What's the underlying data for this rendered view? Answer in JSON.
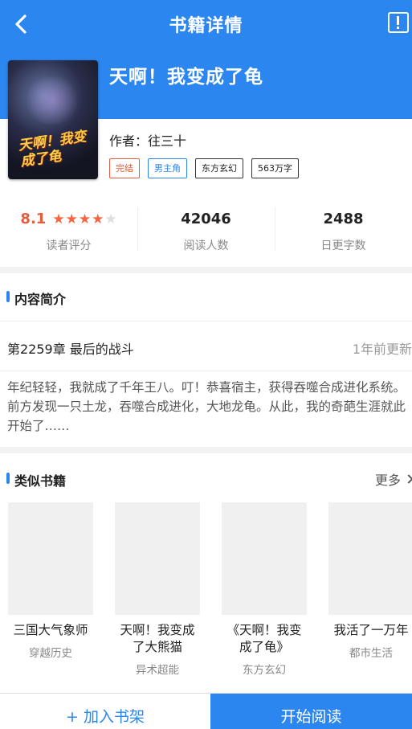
{
  "header": {
    "title": "书籍详情",
    "back_icon": "back-arrow-icon",
    "report_icon": "report-icon"
  },
  "book": {
    "title": "天啊！我变成了龟",
    "author": "作者：往三十",
    "tags": [
      "完结",
      "男主角",
      "东方玄幻",
      "563万字"
    ],
    "cover_text": "天啊！我变成了龟"
  },
  "stats": {
    "rating_value": "8.1",
    "rating_stars_filled": 4,
    "rating_stars_total": 5,
    "rating_label": "读者评分",
    "readers_value": "42046",
    "readers_label": "阅读人数",
    "daily_value": "2488",
    "daily_label": "日更字数"
  },
  "intro": {
    "section_title": "内容简介",
    "latest_chapter": "第2259章 最后的战斗",
    "updated": "1年前更新",
    "text": "年纪轻轻，我就成了千年王八。叮！恭喜宿主，获得吞噬合成进化系统。前方发现一只土龙，吞噬合成进化，大地龙龟。从此，我的奇葩生涯就此开始了……"
  },
  "similar": {
    "section_title": "类似书籍",
    "more_label": "更多",
    "books": [
      {
        "name": "三国大气象师",
        "category": "穿越历史"
      },
      {
        "name": "天啊！我变成了大熊猫",
        "category": "异术超能"
      },
      {
        "name": "《天啊！我变成了龟》",
        "category": "东方玄幻"
      },
      {
        "name": "我活了一万年",
        "category": "都市生活"
      }
    ]
  },
  "footer": {
    "add_label": "+ 加入书架",
    "read_label": "开始阅读"
  },
  "colors": {
    "primary": "#2b86f0",
    "accent": "#e85b3c"
  }
}
